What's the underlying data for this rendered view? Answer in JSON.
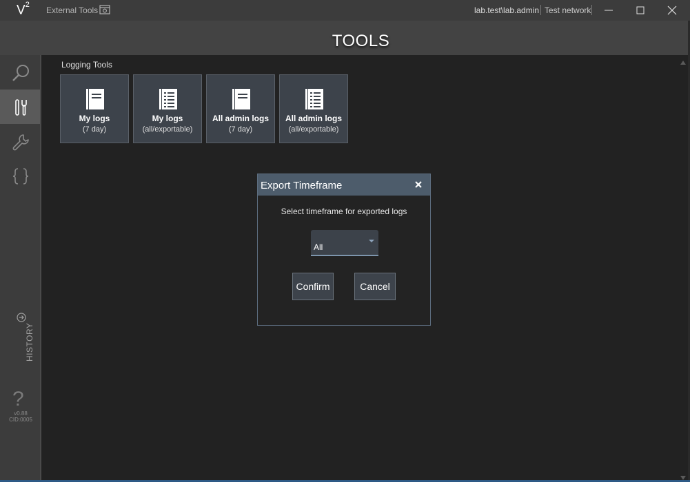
{
  "titlebar": {
    "logo": "V",
    "logo_sup": "2",
    "external_tools_label": "External Tools",
    "user": "lab.test\\lab.admin",
    "network": "Test network"
  },
  "header": {
    "title": "TOOLS"
  },
  "sidebar": {
    "items": [
      {
        "icon": "search-icon"
      },
      {
        "icon": "tools-icon",
        "active": true
      },
      {
        "icon": "wrench-icon"
      },
      {
        "icon": "braces-icon",
        "label": "{ }"
      }
    ],
    "history_label": "HISTORY",
    "help_glyph": "?",
    "version": "v0.88",
    "cid": "CID:0005"
  },
  "section": {
    "title": "Logging Tools",
    "tiles": [
      {
        "line1": "My logs",
        "line2": "(7 day)",
        "icon": "document-icon"
      },
      {
        "line1": "My logs",
        "line2": "(all/exportable)",
        "icon": "list-document-icon"
      },
      {
        "line1": "All admin logs",
        "line2": "(7 day)",
        "icon": "document-icon"
      },
      {
        "line1": "All admin logs",
        "line2": "(all/exportable)",
        "icon": "list-document-icon"
      }
    ]
  },
  "dialog": {
    "title": "Export Timeframe",
    "message": "Select timeframe for exported logs",
    "select_value": "All",
    "confirm_label": "Confirm",
    "cancel_label": "Cancel"
  },
  "colors": {
    "accent": "#4d5c6b",
    "tile_bg": "#3d434b",
    "background": "#222222"
  }
}
